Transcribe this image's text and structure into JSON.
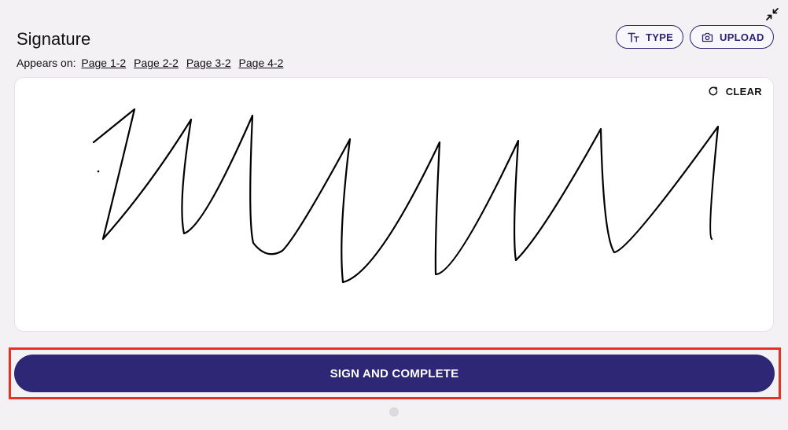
{
  "header": {
    "title": "Signature",
    "appears_on_label": "Appears on:",
    "pages": [
      "Page 1-2",
      "Page 2-2",
      "Page 3-2",
      "Page 4-2"
    ]
  },
  "toolbar": {
    "type_label": "TYPE",
    "type_icon": "text-format-icon",
    "upload_label": "UPLOAD",
    "upload_icon": "camera-icon",
    "collapse_icon": "collapse-arrows-icon"
  },
  "canvas": {
    "clear_label": "CLEAR",
    "clear_icon": "refresh-icon"
  },
  "footer": {
    "submit_label": "SIGN AND COMPLETE"
  },
  "colors": {
    "primary": "#2d2775",
    "background": "#f3f1f4",
    "highlight": "#e8321f"
  }
}
